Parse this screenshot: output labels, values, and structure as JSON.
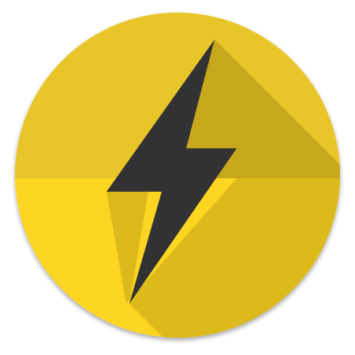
{
  "icon": {
    "name": "lightning-bolt-icon",
    "colors": {
      "disc_upper": "#e8c62a",
      "disc_lower": "#fcd623",
      "upper_long_shadow": "#c7a71f",
      "lower_long_shadow": "#ddba1f",
      "bolt": "#323232",
      "edge_shadow": "#b69a20"
    }
  }
}
